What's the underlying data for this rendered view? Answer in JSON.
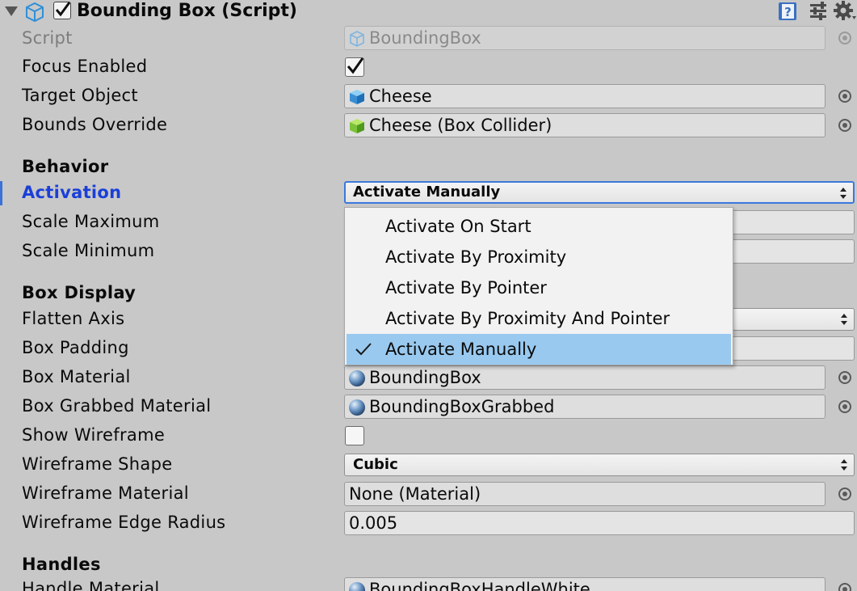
{
  "header": {
    "title": "Bounding Box (Script)",
    "enabled": true
  },
  "fields": {
    "script": {
      "label": "Script",
      "value": "BoundingBox"
    },
    "focus_enabled": {
      "label": "Focus Enabled",
      "checked": true
    },
    "target_object": {
      "label": "Target Object",
      "value": "Cheese"
    },
    "bounds_override": {
      "label": "Bounds Override",
      "value": "Cheese (Box Collider)"
    }
  },
  "behavior": {
    "title": "Behavior",
    "activation": {
      "label": "Activation",
      "value": "Activate Manually"
    },
    "scale_maximum": {
      "label": "Scale Maximum"
    },
    "scale_minimum": {
      "label": "Scale Minimum"
    }
  },
  "box_display": {
    "title": "Box Display",
    "flatten_axis": {
      "label": "Flatten Axis"
    },
    "box_padding": {
      "label": "Box Padding"
    },
    "box_material": {
      "label": "Box Material",
      "value": "BoundingBox"
    },
    "box_grabbed_material": {
      "label": "Box Grabbed Material",
      "value": "BoundingBoxGrabbed"
    },
    "show_wireframe": {
      "label": "Show Wireframe",
      "checked": false
    },
    "wireframe_shape": {
      "label": "Wireframe Shape",
      "value": "Cubic"
    },
    "wireframe_material": {
      "label": "Wireframe Material",
      "value": "None (Material)"
    },
    "wireframe_edge_radius": {
      "label": "Wireframe Edge Radius",
      "value": "0.005"
    }
  },
  "handles": {
    "title": "Handles",
    "handle_material": {
      "label": "Handle Material",
      "value": "BoundingBoxHandleWhite"
    }
  },
  "activation_menu": {
    "items": [
      "Activate On Start",
      "Activate By Proximity",
      "Activate By Pointer",
      "Activate By Proximity And Pointer",
      "Activate Manually"
    ],
    "selected_index": 4
  },
  "colors": {
    "background": "#c8c8c8",
    "active_label": "#1a3fd8",
    "menu_selected": "#99c9ef",
    "focus_border": "#3c78dc"
  },
  "icons": {
    "component": "script-icon",
    "help": "help-icon",
    "presets": "preset-icon",
    "settings": "gear-icon",
    "object": "mesh-icon",
    "material": "material-sphere-icon",
    "picker": "object-picker-icon"
  }
}
